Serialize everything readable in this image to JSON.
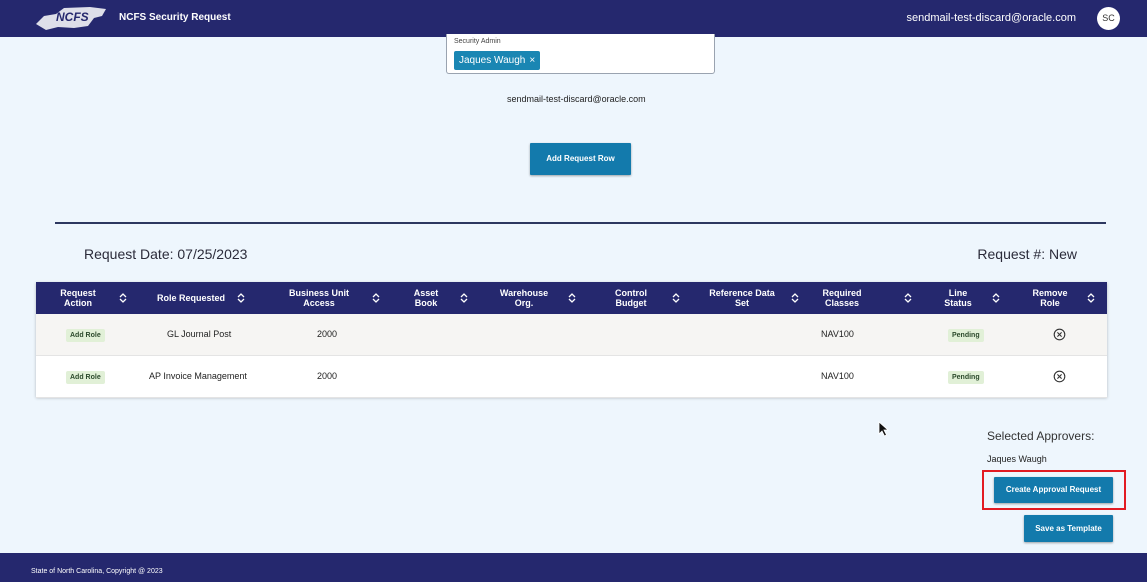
{
  "header": {
    "logo_text": "NCFS",
    "app_title": "NCFS Security Request",
    "user_email": "sendmail-test-discard@oracle.com",
    "avatar_initials": "SC"
  },
  "security_admin": {
    "label": "Security Admin",
    "selected": "Jaques Waugh",
    "remove_symbol": "×",
    "email": "sendmail-test-discard@oracle.com"
  },
  "actions": {
    "add_row_label": "Add Request Row"
  },
  "request": {
    "date_text": "Request Date: 07/25/2023",
    "number_text": "Request #: New"
  },
  "table": {
    "columns": [
      [
        "Request",
        "Action"
      ],
      [
        "Role Requested"
      ],
      [
        "Business Unit",
        "Access"
      ],
      [
        "Asset",
        "Book"
      ],
      [
        "Warehouse",
        "Org."
      ],
      [
        "Control",
        "Budget"
      ],
      [
        "Reference Data",
        "Set"
      ],
      [
        "Required",
        "Classes"
      ],
      [
        "Line",
        "Status"
      ],
      [
        "Remove",
        "Role"
      ]
    ],
    "rows": [
      {
        "action": "Add Role",
        "role": "GL Journal Post",
        "business_unit": "2000",
        "asset_book": "",
        "warehouse_org": "",
        "control_budget": "",
        "reference_data_set": "",
        "required_classes": "NAV100",
        "line_status": "Pending",
        "remove_icon": "circle-x-icon"
      },
      {
        "action": "Add Role",
        "role": "AP Invoice Management",
        "business_unit": "2000",
        "asset_book": "",
        "warehouse_org": "",
        "control_budget": "",
        "reference_data_set": "",
        "required_classes": "NAV100",
        "line_status": "Pending",
        "remove_icon": "circle-x-icon"
      }
    ]
  },
  "approvers": {
    "title": "Selected Approvers:",
    "names": [
      "Jaques Waugh"
    ],
    "create_label": "Create Approval Request",
    "template_label": "Save as Template"
  },
  "footer": {
    "text": "State of North Carolina, Copyright @ 2023"
  },
  "colors": {
    "header": "#25286e",
    "button": "#137aac",
    "background": "#eef6fd",
    "highlight": "#e21b23",
    "status_badge": "#e1f0d7"
  }
}
